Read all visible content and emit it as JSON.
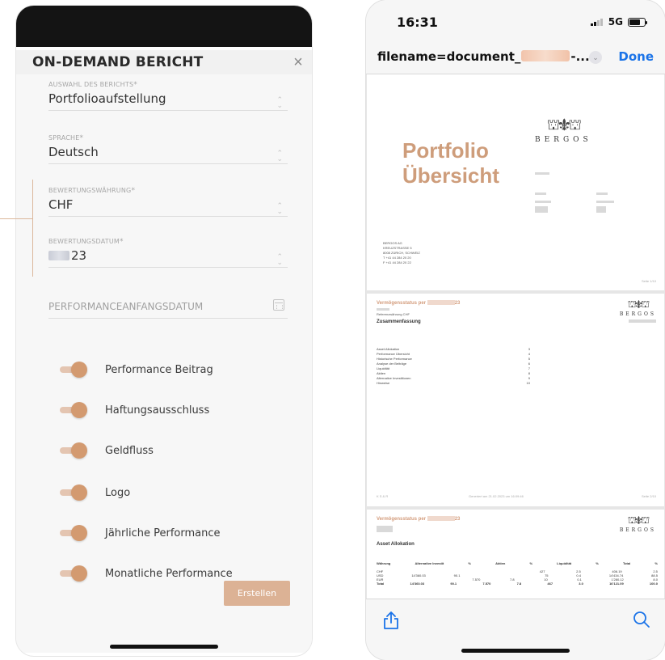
{
  "left": {
    "title": "ON-DEMAND BERICHT",
    "close": "×",
    "fields": {
      "report": {
        "label": "AUSWAHL DES BERICHTS",
        "required": "*",
        "value": "Portfolioaufstellung"
      },
      "language": {
        "label": "SPRACHE",
        "required": "*",
        "value": "Deutsch"
      },
      "currency": {
        "label": "BEWERTUNGSWÄHRUNG",
        "required": "*",
        "value": "CHF"
      },
      "date": {
        "label": "BEWERTUNGSDATUM",
        "required": "*",
        "value": "23"
      },
      "perf_start": {
        "label": "PERFORMANCEANFANGSDATUM"
      }
    },
    "toggles": [
      {
        "label": "Performance Beitrag",
        "on": true
      },
      {
        "label": "Haftungsausschluss",
        "on": true
      },
      {
        "label": "Geldfluss",
        "on": true
      },
      {
        "label": "Logo",
        "on": true
      },
      {
        "label": "Jährliche Performance",
        "on": true
      },
      {
        "label": "Monatliche Performance",
        "on": true
      }
    ],
    "submit": "Erstellen",
    "accent": "#d39a70"
  },
  "right": {
    "status": {
      "time": "16:31",
      "network": "5G"
    },
    "nav": {
      "filename_prefix": "filename=document_",
      "filename_suffix": "-...",
      "done": "Done"
    },
    "page1": {
      "title_line1": "Portfolio",
      "title_line2": "Übersicht",
      "brand": "BERGOS",
      "address": [
        "BERGOS AG",
        "KREUZSTRASSE 5",
        "8008 ZÜRICH, SCHWEIZ",
        "T +41 44 284 20 20",
        "F +41 44 284 20 22"
      ],
      "footer_right": "Seite 1/10"
    },
    "page2": {
      "section": "Vermögensstatus per",
      "section_suffix": "23",
      "sub": "Referenzwährung CHF",
      "heading": "Zusammenfassung",
      "toc": [
        {
          "label": "Asset Allokation",
          "page": "3"
        },
        {
          "label": "Performance Übersicht",
          "page": "4"
        },
        {
          "label": "Historische Performance",
          "page": "5"
        },
        {
          "label": "Analyse der Beiträge",
          "page": "6"
        },
        {
          "label": "Liquidität",
          "page": "7"
        },
        {
          "label": "Aktien",
          "page": "8"
        },
        {
          "label": "Alternative Investitionen",
          "page": "9"
        },
        {
          "label": "Hinweise",
          "page": "10"
        }
      ],
      "footer_left": "K S & R",
      "footer_mid": "Generiert am 21.02.2023 um 16:09:46",
      "footer_right": "Seite 2/10"
    },
    "page3": {
      "section": "Vermögensstatus per",
      "section_suffix": "23",
      "heading": "Asset Allokation",
      "table_head": [
        "Währung",
        "Alternative Investit",
        "%",
        "Aktien",
        "%",
        "Liquidität",
        "%",
        "Total",
        "%"
      ],
      "rows": [
        [
          "CHF",
          "",
          "",
          "",
          "",
          "427",
          "2.5",
          "406.19",
          "2.5"
        ],
        [
          "USD",
          "14'360.03",
          "90.1",
          "",
          "",
          "75",
          "0.4",
          "14'434.74",
          "88.5"
        ],
        [
          "EUR",
          "",
          "",
          "7.570",
          "7.8",
          "10",
          "0.1",
          "1'280.12",
          "8.0"
        ],
        [
          "Total",
          "14'360.03",
          "90.1",
          "7.570",
          "7.8",
          "467",
          "3.0",
          "16'121.09",
          "100.0"
        ]
      ]
    }
  }
}
